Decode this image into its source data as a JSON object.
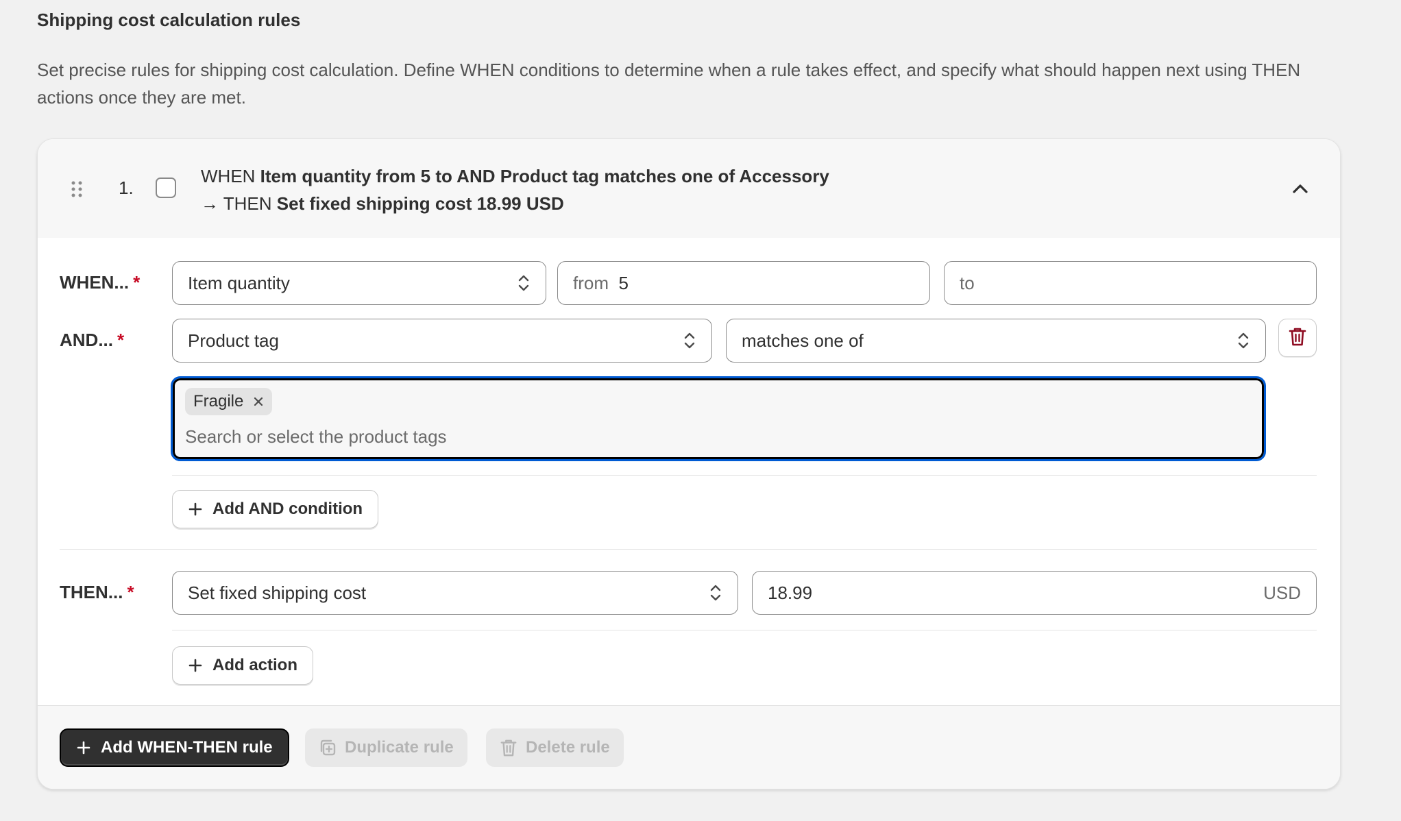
{
  "section": {
    "title": "Shipping cost calculation rules",
    "description": "Set precise rules for shipping cost calculation. Define WHEN conditions to determine when a rule takes effect, and specify what should happen next using THEN actions once they are met."
  },
  "rule": {
    "number": "1.",
    "summary": {
      "when_prefix": "WHEN",
      "when_text": "Item quantity from 5 to AND Product tag matches one of Accessory",
      "then_prefix": "→ THEN",
      "then_text": "Set fixed shipping cost 18.99 USD"
    },
    "when": {
      "label": "WHEN...",
      "required": "*",
      "condition_select": "Item quantity",
      "from_prefix": "from",
      "from_value": "5",
      "to_placeholder": "to"
    },
    "and": {
      "label": "AND...",
      "required": "*",
      "condition_select": "Product tag",
      "operator_select": "matches one of",
      "tags": [
        "Fragile"
      ],
      "tags_placeholder": "Search or select the product tags",
      "add_condition_label": "Add AND condition"
    },
    "then": {
      "label": "THEN...",
      "required": "*",
      "action_select": "Set fixed shipping cost",
      "amount_value": "18.99",
      "currency": "USD",
      "add_action_label": "Add action"
    }
  },
  "footer": {
    "add_rule_label": "Add WHEN-THEN rule",
    "duplicate_label": "Duplicate rule",
    "delete_label": "Delete rule"
  },
  "colors": {
    "required": "#c70a24",
    "focus": "#005bd3",
    "primary": "#303030",
    "danger_icon": "#8e0b21"
  }
}
